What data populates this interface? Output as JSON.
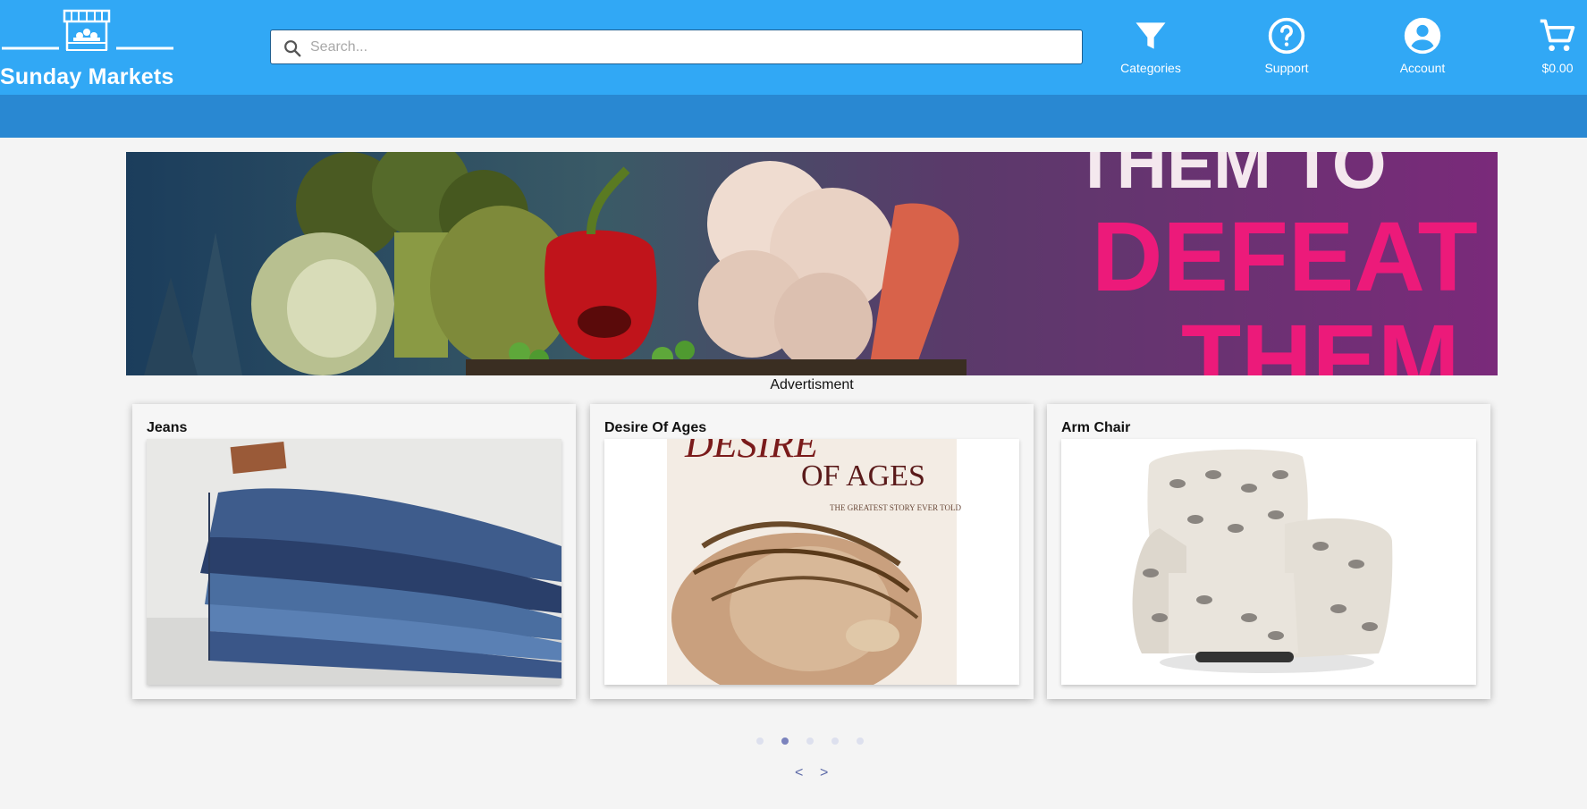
{
  "brand": {
    "name": "Sunday Markets"
  },
  "search": {
    "placeholder": "Search..."
  },
  "nav": {
    "categories": "Categories",
    "support": "Support",
    "account": "Account",
    "cart": "$0.00"
  },
  "banner": {
    "text_top": "THEM TO",
    "text_mid": "DEFEAT",
    "text_bottom": "THEM"
  },
  "ad_caption": "Advertisment",
  "products": [
    {
      "title": "Jeans"
    },
    {
      "title": "Desire Of Ages",
      "cover_title": "DESIRE",
      "cover_sub": "OF AGES",
      "cover_tagline": "THE GREATEST STORY EVER TOLD"
    },
    {
      "title": "Arm Chair"
    }
  ],
  "carousel": {
    "active_index": 1,
    "count": 5
  },
  "pager": {
    "prev": "<",
    "next": ">"
  },
  "colors": {
    "topbar": "#31a8f5",
    "subbar": "#2988d2",
    "background": "#f4f4f4"
  }
}
